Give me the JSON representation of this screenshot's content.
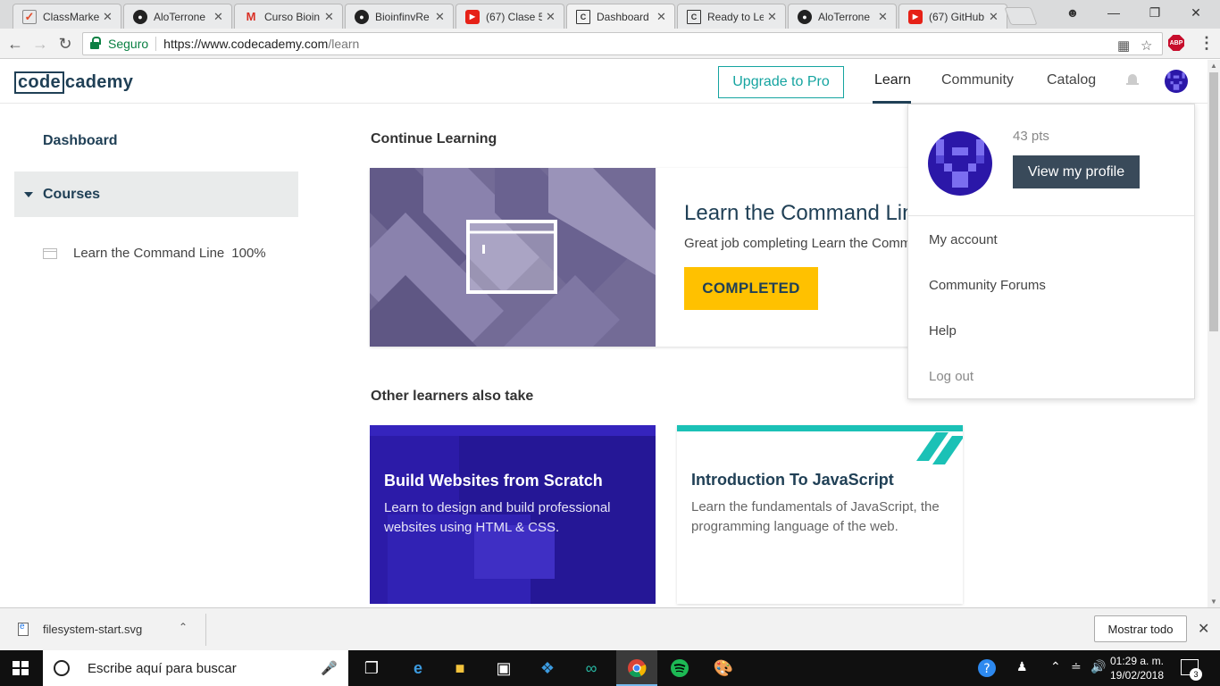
{
  "browser": {
    "tabs": [
      {
        "label": "ClassMarke",
        "icon": "classmarker-icon"
      },
      {
        "label": "AloTerrone",
        "icon": "github-icon"
      },
      {
        "label": "Curso Bioin",
        "icon": "gmail-icon"
      },
      {
        "label": "BioinfinvRe",
        "icon": "github-icon"
      },
      {
        "label": "(67) Clase 5",
        "icon": "youtube-icon"
      },
      {
        "label": "Dashboard",
        "icon": "codecademy-icon",
        "active": true
      },
      {
        "label": "Ready to Le",
        "icon": "codecademy-icon"
      },
      {
        "label": "AloTerrone",
        "icon": "github-icon"
      },
      {
        "label": "(67) GitHub",
        "icon": "youtube-icon"
      }
    ],
    "secure_label": "Seguro",
    "url_host": "https://www.codecademy.com",
    "url_path": "/learn"
  },
  "header": {
    "logo_code": "code",
    "logo_rest": "cademy",
    "upgrade_label": "Upgrade to Pro",
    "nav": {
      "learn": "Learn",
      "community": "Community",
      "catalog": "Catalog"
    }
  },
  "sidebar": {
    "dashboard": "Dashboard",
    "courses": "Courses",
    "items": [
      {
        "label": "Learn the Command Line",
        "progress": "100%"
      }
    ]
  },
  "main": {
    "continue_heading": "Continue Learning",
    "course_title": "Learn the Command Line",
    "course_desc": "Great job completing Learn the Command Line!",
    "completed_label": "COMPLETED",
    "other_heading": "Other learners also take",
    "cards": [
      {
        "title": "Build Websites from Scratch",
        "desc": "Learn to design and build professional websites using HTML & CSS."
      },
      {
        "title": "Introduction To JavaScript",
        "desc": "Learn the fundamentals of JavaScript, the programming language of the web."
      }
    ]
  },
  "profile_menu": {
    "points": "43 pts",
    "view_profile": "View my profile",
    "my_account": "My account",
    "forums": "Community Forums",
    "help": "Help",
    "logout": "Log out"
  },
  "downloads": {
    "filename": "filesystem-start.svg",
    "show_all": "Mostrar todo"
  },
  "taskbar": {
    "search_placeholder": "Escribe aquí para buscar",
    "time": "01:29 a. m.",
    "date": "19/02/2018",
    "notifications": "3"
  },
  "colors": {
    "brand_navy": "#204056",
    "accent_teal": "#15a4a0",
    "completed_yellow": "#ffc100",
    "purple": "#2c1ba8"
  }
}
